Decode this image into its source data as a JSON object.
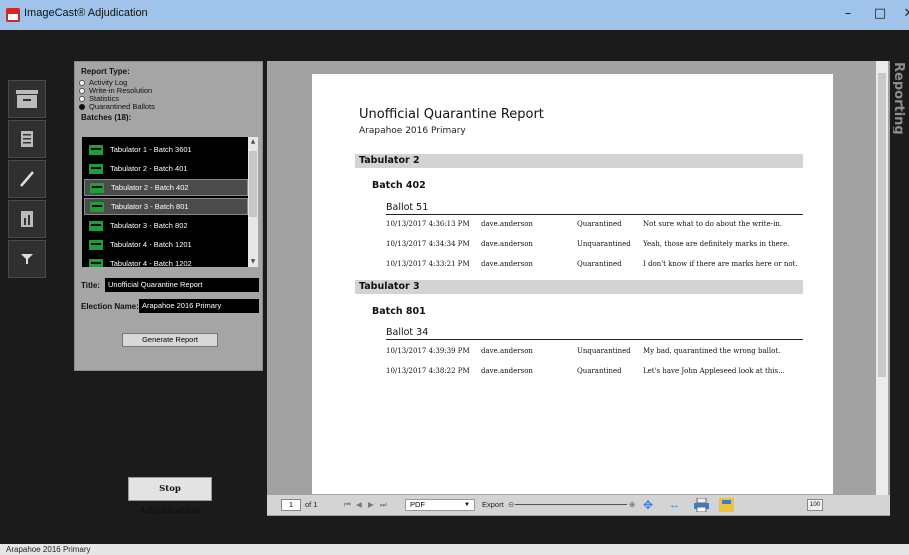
{
  "window": {
    "title": "ImageCast® Adjudication",
    "minimize": "–",
    "maximize": "□",
    "close": "✕"
  },
  "side_label": "Reporting",
  "left_panel": {
    "report_type_label": "Report Type:",
    "report_types": [
      "Activity Log",
      "Write-in Resolution",
      "Statistics",
      "Quarantined Ballots"
    ],
    "selected_report_type": "Quarantined Ballots",
    "batches_label": "Batches (18):",
    "batches": [
      "Tabulator 1 - Batch 3601",
      "Tabulator 2 - Batch 401",
      "Tabulator 2 - Batch 402",
      "Tabulator 3 - Batch 801",
      "Tabulator 3 - Batch 802",
      "Tabulator 4 - Batch 1201",
      "Tabulator 4 - Batch 1202"
    ],
    "title_label": "Title:",
    "title_value": "Unofficial Quarantine Report",
    "election_label": "Election Name:",
    "election_value": "Arapahoe 2016 Primary",
    "generate_button": "Generate Report"
  },
  "stop_button": "Stop Adjudication",
  "report": {
    "title": "Unofficial Quarantine Report",
    "subtitle": "Arapahoe 2016 Primary",
    "tabulators": [
      {
        "name": "Tabulator 2",
        "batch": "Batch 402",
        "ballot": "Ballot 51",
        "rows": [
          {
            "time": "10/13/2017 4:36:13 PM",
            "user": "dave.anderson",
            "status": "Quarantined",
            "note": "Not sure what to do about the write-in."
          },
          {
            "time": "10/13/2017 4:34:34 PM",
            "user": "dave.anderson",
            "status": "Unquarantined",
            "note": "Yeah, those are definitely marks in there."
          },
          {
            "time": "10/13/2017 4:33:21 PM",
            "user": "dave.anderson",
            "status": "Quarantined",
            "note": "I don't know if there are marks here or not."
          }
        ]
      },
      {
        "name": "Tabulator 3",
        "batch": "Batch 801",
        "ballot": "Ballot 34",
        "rows": [
          {
            "time": "10/13/2017 4:39:39 PM",
            "user": "dave.anderson",
            "status": "Unquarantined",
            "note": "My bad, quarantined the wrong ballot."
          },
          {
            "time": "10/13/2017 4:38:22 PM",
            "user": "dave.anderson",
            "status": "Quarantined",
            "note": "Let's have John Appleseed look at this..."
          }
        ]
      }
    ]
  },
  "viewer_toolbar": {
    "page": "1",
    "of_label": "of 1",
    "export_format": "PDF",
    "export_label": "Export",
    "zoom": "100"
  },
  "status_bar": "Arapahoe 2016 Primary",
  "colors": {
    "accent_green": "#1f9d3a",
    "title_bar": "#9fc3ea"
  }
}
